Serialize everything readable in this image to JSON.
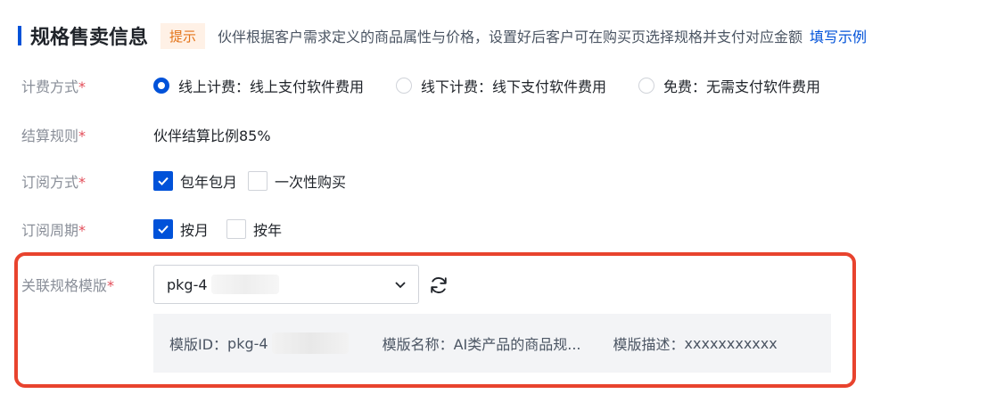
{
  "header": {
    "title": "规格售卖信息",
    "tip_badge": "提示",
    "tip_text": "伙伴根据客户需求定义的商品属性与价格，设置好后客户可在购买页选择规格并支付对应金额",
    "example_link": "填写示例"
  },
  "billing": {
    "label": "计费方式",
    "required_mark": "*",
    "options": [
      {
        "label": "线上计费：线上支付软件费用",
        "checked": true
      },
      {
        "label": "线下计费：线下支付软件费用",
        "checked": false
      },
      {
        "label": "免费：无需支付软件费用",
        "checked": false
      }
    ]
  },
  "settlement": {
    "label": "结算规则",
    "required_mark": "*",
    "value": "伙伴结算比例85%"
  },
  "subscription_method": {
    "label": "订阅方式",
    "required_mark": "*",
    "options": [
      {
        "label": "包年包月",
        "checked": true
      },
      {
        "label": "一次性购买",
        "checked": false
      }
    ]
  },
  "subscription_period": {
    "label": "订阅周期",
    "required_mark": "*",
    "options": [
      {
        "label": "按月",
        "checked": true
      },
      {
        "label": "按年",
        "checked": false
      }
    ]
  },
  "template": {
    "label": "关联规格模版",
    "required_mark": "*",
    "selected_value": "pkg-4",
    "info": {
      "id_label": "模版ID：",
      "id_value": "pkg-4",
      "name_label": "模版名称：",
      "name_value": "AI类产品的商品规...",
      "desc_label": "模版描述：",
      "desc_value": "xxxxxxxxxxx"
    }
  },
  "colors": {
    "accent": "#0052d9",
    "highlight_border": "#e8432e",
    "required": "#e34d59",
    "tip_badge_bg": "#fff1e6",
    "tip_badge_text": "#e37318"
  },
  "icons": {
    "select_arrow": "chevron-down-icon",
    "refresh": "refresh-icon",
    "check": "checkmark-icon"
  }
}
